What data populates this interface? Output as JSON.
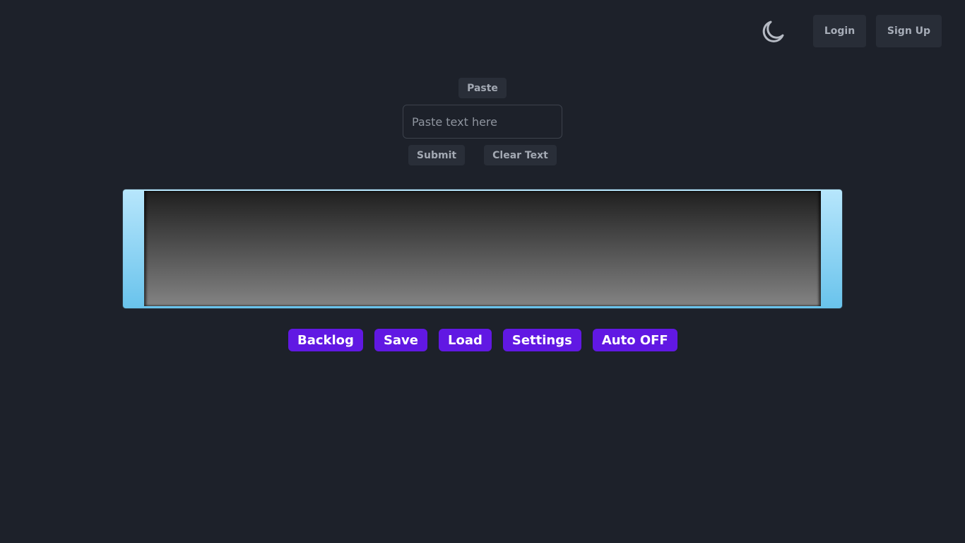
{
  "header": {
    "theme_toggle_icon": "moon-icon",
    "login_label": "Login",
    "signup_label": "Sign Up"
  },
  "paste_area": {
    "paste_label": "Paste",
    "input_value": "",
    "input_placeholder": "Paste text here",
    "submit_label": "Submit",
    "clear_label": "Clear Text"
  },
  "dialogue_box": {
    "text": ""
  },
  "controls": [
    {
      "label": "Backlog"
    },
    {
      "label": "Save"
    },
    {
      "label": "Load"
    },
    {
      "label": "Settings"
    },
    {
      "label": "Auto OFF"
    }
  ],
  "colors": {
    "background": "#1d212a",
    "accent": "#6118e3",
    "frame_light": "#b7e6fc",
    "frame_dark": "#69c3ec"
  }
}
